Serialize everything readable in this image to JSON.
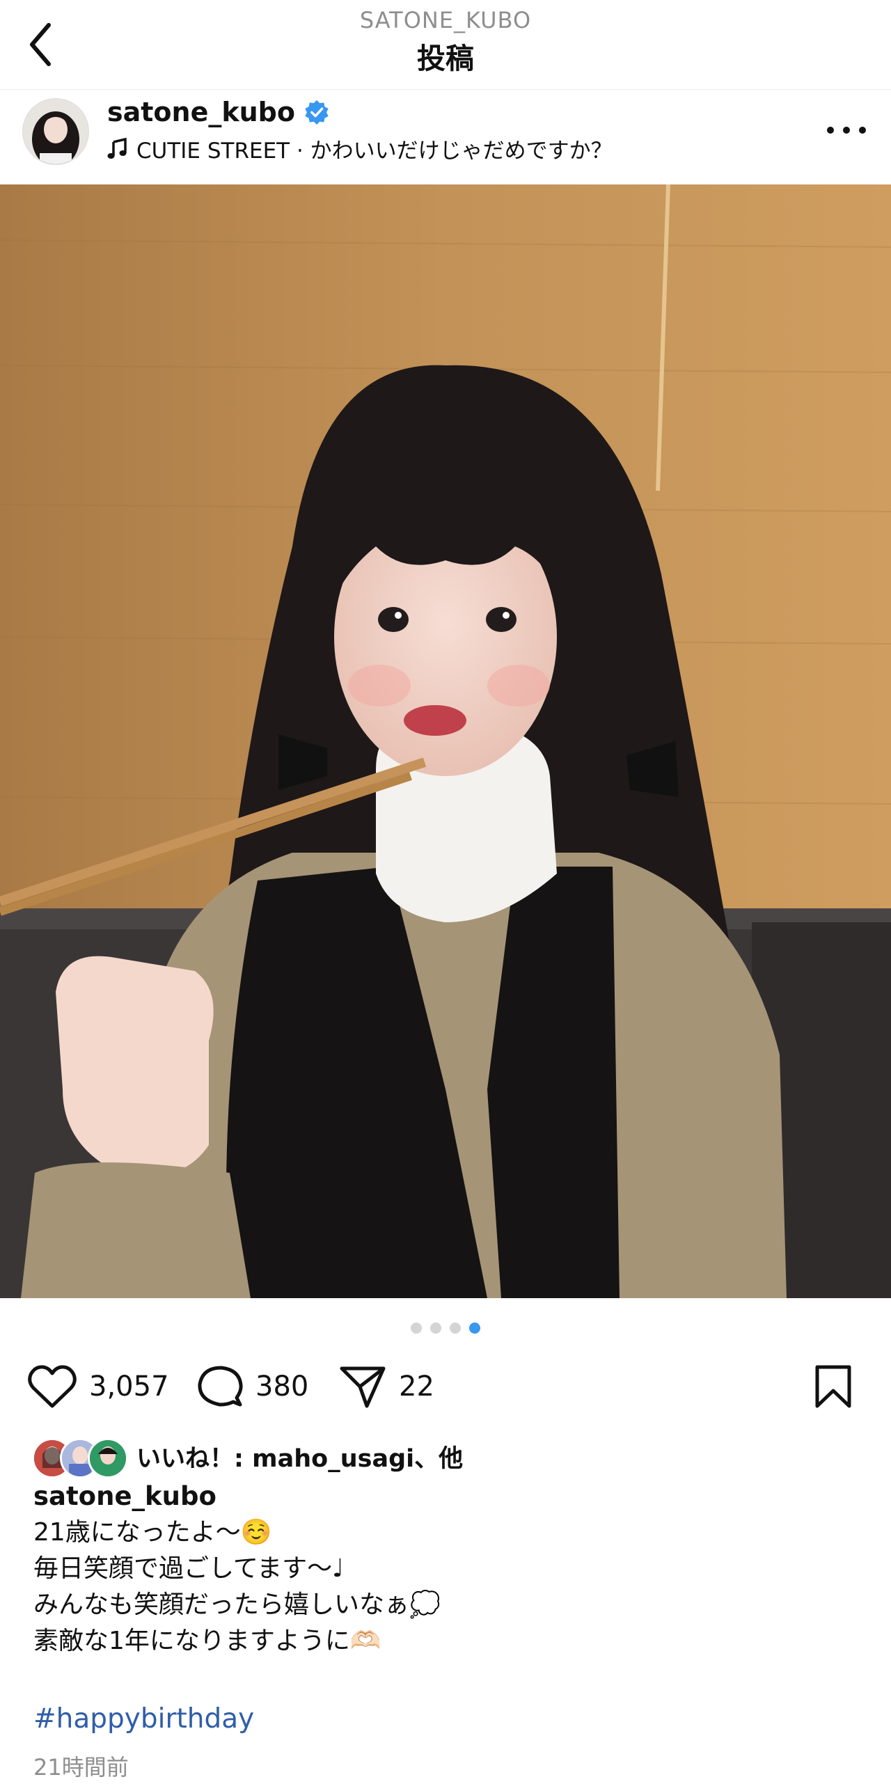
{
  "header": {
    "username_caps": "SATONE_KUBO",
    "title": "投稿"
  },
  "post": {
    "username": "satone_kubo",
    "music": "CUTIE STREET · かわいいだけじゃだめですか？"
  },
  "carousel": {
    "count": 4,
    "active_index": 3
  },
  "actions": {
    "likes_count": "3,057",
    "comments_count": "380",
    "shares_count": "22"
  },
  "liked_by": "いいね！: maho_usagi、他",
  "caption": {
    "username": "satone_kubo",
    "lines": [
      "21歳になったよ〜☺️",
      "毎日笑顔で過ごしてます〜♩",
      "みんなも笑顔だったら嬉しいなぁ💭",
      "素敵な1年になりますように🫶🏻"
    ],
    "hashtag": "#happybirthday",
    "time_ago": "21時間前"
  },
  "colors": {
    "accent": "#3897f0",
    "hashtag": "#2f5ea8",
    "muted": "#8e8e8e"
  },
  "icons": [
    "back-chevron-icon",
    "verified-badge-icon",
    "music-note-icon",
    "more-dots-icon",
    "mute-icon",
    "heart-icon",
    "comment-icon",
    "share-icon",
    "bookmark-icon"
  ]
}
